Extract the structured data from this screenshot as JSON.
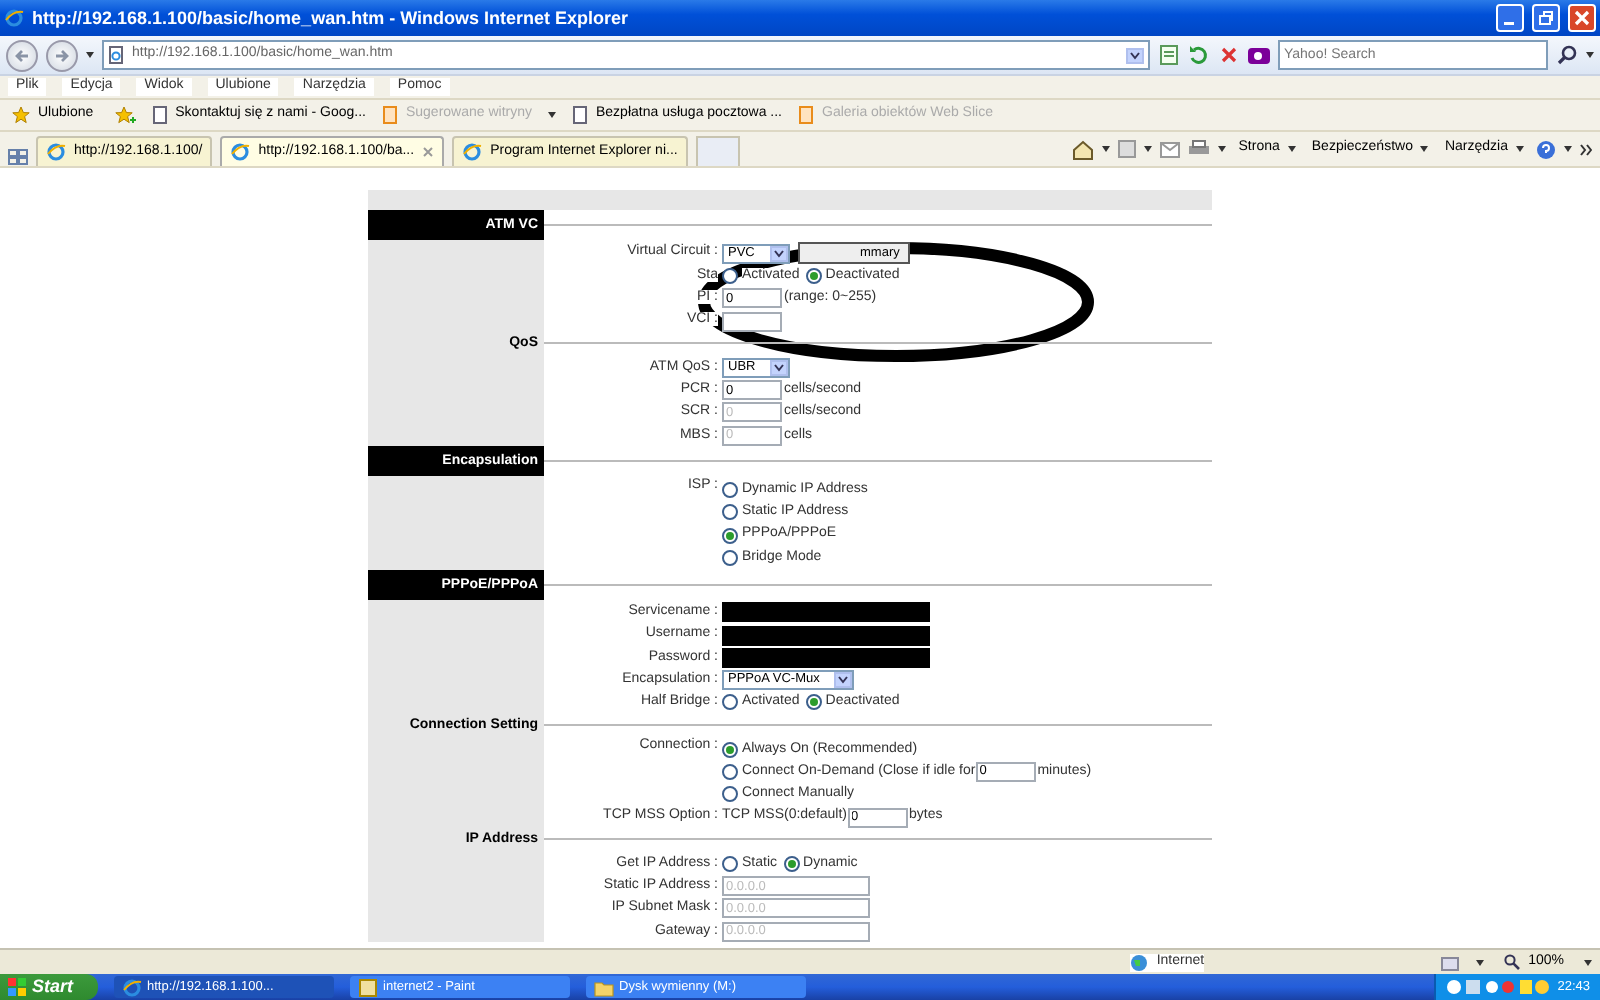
{
  "window": {
    "title": "http://192.168.1.100/basic/home_wan.htm - Windows Internet Explorer"
  },
  "address_bar": {
    "url": "http://192.168.1.100/basic/home_wan.htm"
  },
  "search": {
    "placeholder": "Yahoo! Search"
  },
  "menu": [
    "Plik",
    "Edycja",
    "Widok",
    "Ulubione",
    "Narzędzia",
    "Pomoc"
  ],
  "favorites": {
    "label": "Ulubione",
    "links": [
      {
        "label": "Skontaktuj się z nami - Goog...",
        "disabled": false
      },
      {
        "label": "Sugerowane witryny",
        "disabled": true
      },
      {
        "label": "Bezpłatna usługa pocztowa ...",
        "disabled": false
      },
      {
        "label": "Galeria obiektów Web Slice",
        "disabled": true
      }
    ]
  },
  "tabs": [
    {
      "label": "http://192.168.1.100/",
      "selected": false
    },
    {
      "label": "http://192.168.1.100/ba...",
      "selected": true
    },
    {
      "label": "Program Internet Explorer ni...",
      "selected": false
    }
  ],
  "commands": [
    "Strona",
    "Bezpieczeństwo",
    "Narzędzia"
  ],
  "sections": [
    {
      "title": "ATM VC",
      "kind": "bar",
      "rows": [
        {
          "kind": "select",
          "label": "Virtual Circuit :",
          "value": "PVC",
          "button": "mmary"
        },
        {
          "kind": "radios",
          "label": "Sta",
          "options": [
            {
              "label": "Activated",
              "selected": false
            },
            {
              "label": "Deactivated",
              "selected": true
            }
          ]
        },
        {
          "kind": "input",
          "label": "PI :",
          "value": "0",
          "suffix": "(range: 0~255)"
        },
        {
          "kind": "input",
          "label": "VCI :"
        }
      ]
    },
    {
      "title": "QoS",
      "kind": "plain",
      "rows": [
        {
          "kind": "select",
          "label": "ATM QoS :",
          "value": "UBR"
        },
        {
          "kind": "input",
          "label": "PCR :",
          "value": "0",
          "suffix": "cells/second",
          "disabled": false
        },
        {
          "kind": "input",
          "label": "SCR :",
          "value": "0",
          "suffix": "cells/second",
          "disabled": true
        },
        {
          "kind": "input",
          "label": "MBS :",
          "value": "0",
          "suffix": "cells",
          "disabled": true
        }
      ]
    },
    {
      "title": "Encapsulation",
      "kind": "bar",
      "rows": [
        {
          "kind": "radio-list",
          "label": "ISP :",
          "options": [
            {
              "label": "Dynamic IP Address",
              "selected": false
            },
            {
              "label": "Static IP Address",
              "selected": false
            },
            {
              "label": "PPPoA/PPPoE",
              "selected": true
            },
            {
              "label": "Bridge Mode",
              "selected": false
            }
          ]
        }
      ]
    },
    {
      "title": "PPPoE/PPPoA",
      "kind": "bar",
      "rows": [
        {
          "kind": "input",
          "label": "Servicename :",
          "redacted": true
        },
        {
          "kind": "input",
          "label": "Username :",
          "redacted": true
        },
        {
          "kind": "input",
          "label": "Password :",
          "redacted": true
        },
        {
          "kind": "select",
          "label": "Encapsulation :",
          "value": "PPPoA VC-Mux"
        },
        {
          "kind": "radios",
          "label": "Half Bridge :",
          "options": [
            {
              "label": "Activated",
              "selected": false
            },
            {
              "label": "Deactivated",
              "selected": true
            }
          ]
        }
      ]
    },
    {
      "title": "Connection Setting",
      "kind": "plain",
      "rows": [
        {
          "kind": "radio-list",
          "label": "Connection :",
          "options": [
            {
              "label": "Always On (Recommended)",
              "selected": true
            },
            {
              "label": "Connect On-Demand (Close if idle for",
              "selected": false,
              "value": "0",
              "suffix": "minutes)"
            },
            {
              "label": "Connect Manually",
              "selected": false
            }
          ]
        },
        {
          "kind": "input",
          "label": "TCP MSS Option :",
          "prefix": "TCP MSS(0:default)",
          "value": "0",
          "suffix": "bytes"
        }
      ]
    },
    {
      "title": "IP Address",
      "kind": "plain",
      "rows": [
        {
          "kind": "radios",
          "label": "Get IP Address :",
          "options": [
            {
              "label": "Static",
              "selected": false
            },
            {
              "label": "Dynamic",
              "selected": true
            }
          ]
        },
        {
          "kind": "input",
          "label": "Static IP Address :",
          "value": "0.0.0.0",
          "disabled": true
        },
        {
          "kind": "input",
          "label": "IP Subnet Mask :",
          "value": "0.0.0.0",
          "disabled": true
        },
        {
          "kind": "input",
          "label": "Gateway :",
          "value": "0.0.0.0",
          "disabled": true
        }
      ]
    }
  ],
  "status_bar": {
    "zone": "Internet",
    "zoom": "100%"
  },
  "taskbar": {
    "start": "Start",
    "tasks": [
      {
        "label": "http://192.168.1.100...",
        "selected": true
      },
      {
        "label": "internet2 - Paint",
        "selected": false
      },
      {
        "label": "Dysk wymienny (M:)",
        "selected": false
      }
    ],
    "clock": "22:43"
  }
}
